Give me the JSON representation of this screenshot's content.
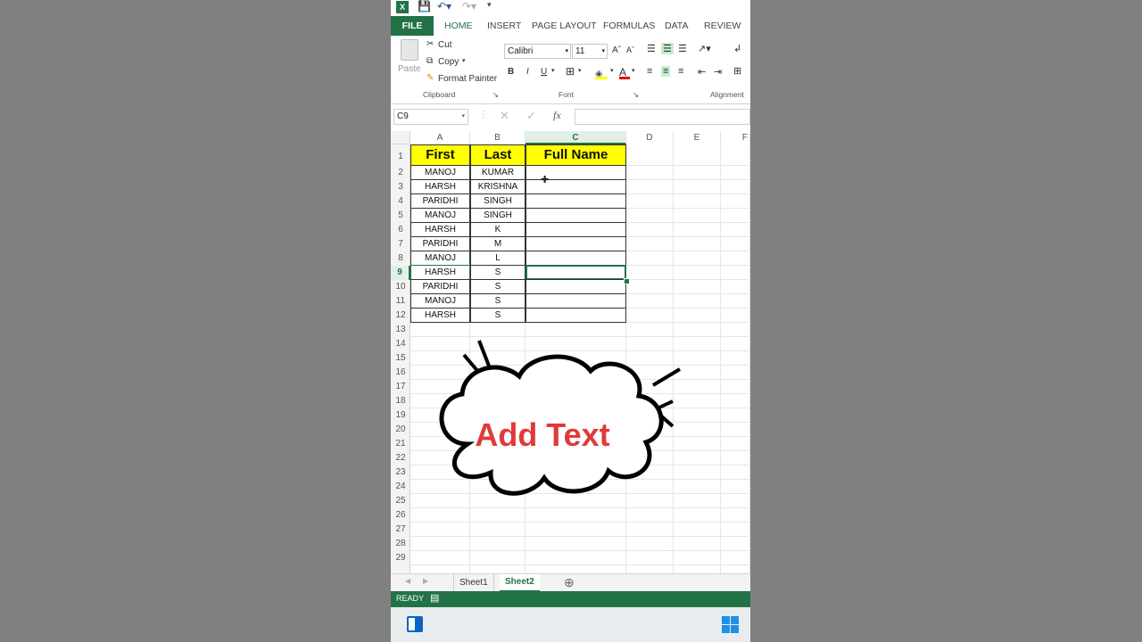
{
  "app": {
    "name": "Excel"
  },
  "ribbon_tabs": [
    "FILE",
    "HOME",
    "INSERT",
    "PAGE LAYOUT",
    "FORMULAS",
    "DATA",
    "REVIEW"
  ],
  "active_tab": "HOME",
  "clipboard": {
    "paste": "Paste",
    "cut": "Cut",
    "copy": "Copy",
    "format_painter": "Format Painter",
    "group": "Clipboard"
  },
  "font": {
    "name": "Calibri",
    "size": "11",
    "group": "Font",
    "bold": "B",
    "italic": "I",
    "underline": "U"
  },
  "alignment": {
    "group": "Alignment"
  },
  "name_box": "C9",
  "fx": "fx",
  "columns": [
    "A",
    "B",
    "C",
    "D",
    "E",
    "F"
  ],
  "header_row": {
    "a": "First",
    "b": "Last",
    "c": "Full Name"
  },
  "rows": [
    {
      "a": "MANOJ",
      "b": "KUMAR"
    },
    {
      "a": "HARSH",
      "b": "KRISHNA"
    },
    {
      "a": "PARIDHI",
      "b": "SINGH"
    },
    {
      "a": "MANOJ",
      "b": "SINGH"
    },
    {
      "a": "HARSH",
      "b": "K"
    },
    {
      "a": "PARIDHI",
      "b": "M"
    },
    {
      "a": "MANOJ",
      "b": "L"
    },
    {
      "a": "HARSH",
      "b": "S"
    },
    {
      "a": "PARIDHI",
      "b": "S"
    },
    {
      "a": "MANOJ",
      "b": "S"
    },
    {
      "a": "HARSH",
      "b": "S"
    }
  ],
  "row_numbers": [
    "1",
    "2",
    "3",
    "4",
    "5",
    "6",
    "7",
    "8",
    "9",
    "10",
    "11",
    "12",
    "13",
    "14",
    "15",
    "16",
    "17",
    "18",
    "19",
    "20",
    "21",
    "22",
    "23",
    "24",
    "25",
    "26",
    "27",
    "28",
    "29"
  ],
  "sheets": [
    "Sheet1",
    "Sheet2"
  ],
  "active_sheet": "Sheet2",
  "status": "READY",
  "overlay_text": "Add Text",
  "colors": {
    "excel_green": "#217346",
    "header_fill": "#ffff00",
    "overlay_red": "#e03a3a"
  }
}
